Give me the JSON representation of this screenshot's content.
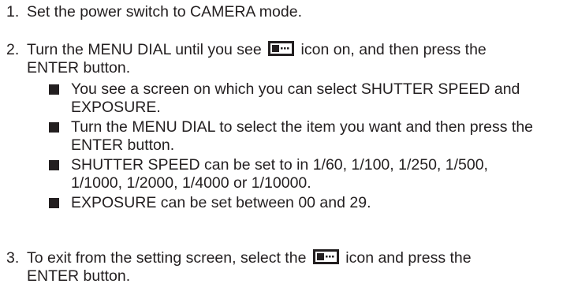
{
  "colors": {
    "text": "#231f20",
    "icon": "#231f20",
    "background": "#ffffff"
  },
  "icon_name": "menu-setting-icon",
  "step1": {
    "num": "1.",
    "text": "Set the power switch to CAMERA mode."
  },
  "step2": {
    "num": "2.",
    "line1_pre": "Turn the MENU DIAL until you see",
    "line1_post": "icon on, and then press the",
    "line2": "ENTER button.",
    "bullets": [
      [
        "You see a screen on which you can select SHUTTER SPEED and",
        "EXPOSURE."
      ],
      [
        "Turn the MENU DIAL to select the item you want and then press the",
        "ENTER button."
      ],
      [
        "SHUTTER SPEED can be set to in 1/60, 1/100, 1/250, 1/500,",
        "1/1000, 1/2000, 1/4000 or 1/10000."
      ],
      [
        "EXPOSURE can be set between 00 and 29."
      ]
    ]
  },
  "step3": {
    "num": "3.",
    "line1_pre": "To exit from the setting screen, select the",
    "line1_post": "icon and press the",
    "line2": "ENTER button."
  }
}
